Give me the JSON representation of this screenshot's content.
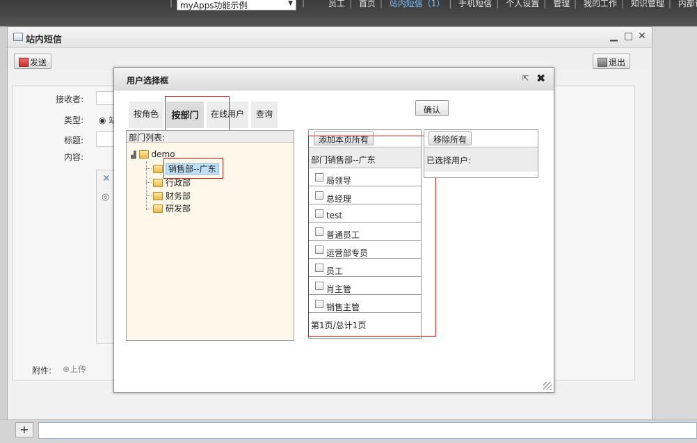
{
  "header": {
    "app_select": "myApps功能示例",
    "nav": [
      "员工",
      "首页",
      "站内短信（1）",
      "手机短信",
      "个人设置",
      "管理",
      "我的工作",
      "知识管理",
      "内部论"
    ]
  },
  "window": {
    "title": "站内短信",
    "send_label": "发送",
    "exit_label": "退出",
    "fields": {
      "receiver": "接收者:",
      "type": "类型:",
      "type_radio": "站",
      "subject": "标题:",
      "content": "内容:",
      "attachment": "附件:",
      "upload": "上传"
    }
  },
  "dialog": {
    "title": "用户选择框",
    "tabs": [
      "按角色",
      "按部门",
      "在线用户",
      "查询"
    ],
    "confirm_label": "确认",
    "dept_header": "部门列表:",
    "tree": {
      "root": "demo",
      "children": [
        "销售部--广东",
        "行政部",
        "财务部",
        "研发部"
      ]
    },
    "add_page_label": "添加本页所有",
    "current_dept": "部门销售部--广东",
    "users": [
      "局领导",
      "总经理",
      "test",
      "普通员工",
      "运营部专员",
      "员工",
      "肖主管",
      "销售主管"
    ],
    "pager": "第1页/总计1页",
    "remove_all_label": "移除所有",
    "selected_label": "已选择用户:"
  }
}
